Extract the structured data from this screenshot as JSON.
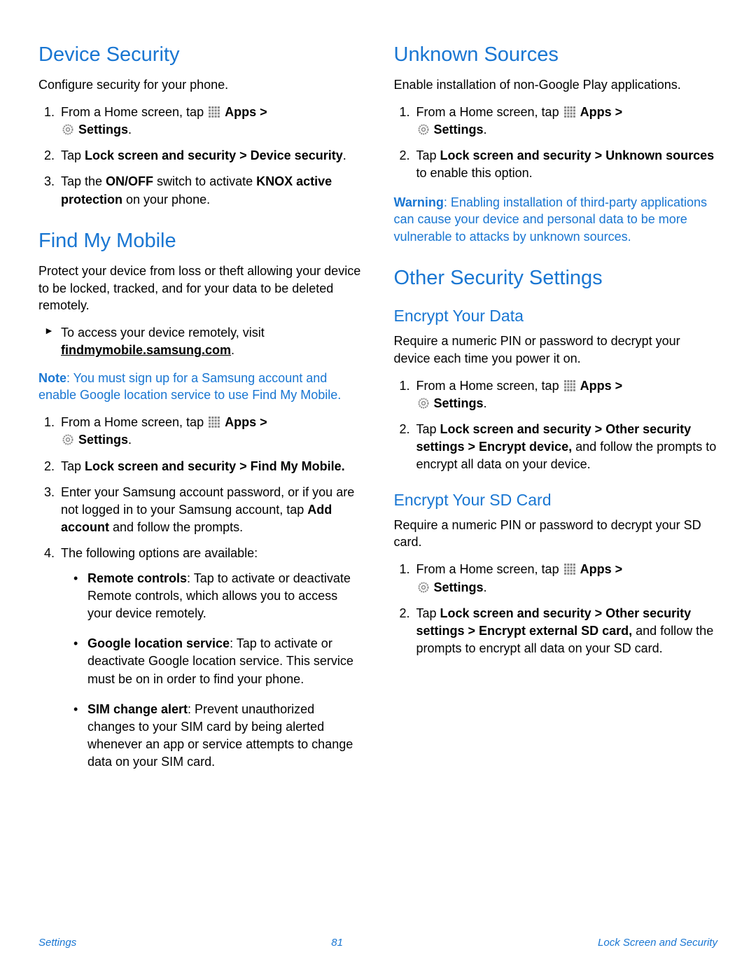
{
  "left": {
    "device_security": {
      "title": "Device Security",
      "intro": "Configure security for your phone.",
      "step1a": "From a Home screen, tap ",
      "apps": "Apps",
      "gt": " > ",
      "settings": "Settings",
      "period": ".",
      "step2a": "Tap ",
      "step2b": "Lock screen and security > Device security",
      "step3a": "Tap the ",
      "step3b": "ON/OFF",
      "step3c": " switch to activate ",
      "step3d": "KNOX active protection",
      "step3e": " on your phone."
    },
    "find_my_mobile": {
      "title": "Find My Mobile",
      "intro": "Protect your device from loss or theft allowing your device to be locked, tracked, and for your data to be deleted remotely.",
      "arrow1a": "To access your device remotely, visit ",
      "arrow1b": "findmymobile.samsung.com",
      "note_label": "Note",
      "note_text": ": You must sign up for a Samsung account and enable Google location service to use Find My Mobile.",
      "step1a": "From a Home screen, tap ",
      "apps": "Apps",
      "gt": " > ",
      "settings": "Settings",
      "period": ".",
      "step2a": "Tap ",
      "step2b": "Lock screen and security > Find My Mobile.",
      "step3a": "Enter your Samsung account password, or if you are not logged in to your Samsung account, tap ",
      "step3b": "Add account",
      "step3c": " and follow the prompts.",
      "step4": "The following options are available:",
      "opt1a": "Remote controls",
      "opt1b": ": Tap to activate or deactivate Remote controls, which allows you to access your device remotely.",
      "opt2a": "Google location service",
      "opt2b": ": Tap to activate or deactivate Google location service. This service must be on in order to find your phone.",
      "opt3a": "SIM change alert",
      "opt3b": ": Prevent unauthorized changes to your SIM card by being alerted whenever an app or service attempts to change data on your SIM card."
    }
  },
  "right": {
    "unknown_sources": {
      "title": "Unknown Sources",
      "intro": "Enable installation of non-Google Play applications.",
      "step1a": "From a Home screen, tap ",
      "apps": "Apps",
      "gt": " > ",
      "settings": "Settings",
      "period": ".",
      "step2a": "Tap ",
      "step2b": "Lock screen and security > Unknown sources",
      "step2c": " to enable this option.",
      "warn_label": "Warning",
      "warn_text": ": Enabling installation of third-party applications can cause your device and personal data to be more vulnerable to attacks by unknown sources."
    },
    "other": {
      "title": "Other Security Settings",
      "encrypt_data": {
        "title": "Encrypt Your Data",
        "intro": "Require a numeric PIN or password to decrypt your device each time you power it on.",
        "step1a": "From a Home screen, tap ",
        "apps": "Apps",
        "gt": " > ",
        "settings": "Settings",
        "period": ".",
        "step2a": "Tap ",
        "step2b": "Lock screen and security > Other security settings > Encrypt device,",
        "step2c": " and follow the prompts to encrypt all data on your device."
      },
      "encrypt_sd": {
        "title": "Encrypt Your SD Card",
        "intro": "Require a numeric PIN or password to decrypt your SD card.",
        "step1a": "From a Home screen, tap ",
        "apps": "Apps",
        "gt": " > ",
        "settings": "Settings",
        "period": ".",
        "step2a": "Tap ",
        "step2b": "Lock screen and security > Other security settings > Encrypt external SD card,",
        "step2c": " and follow the prompts to encrypt all data on your SD card."
      }
    }
  },
  "footer": {
    "left": "Settings",
    "center": "81",
    "right": "Lock Screen and Security"
  }
}
